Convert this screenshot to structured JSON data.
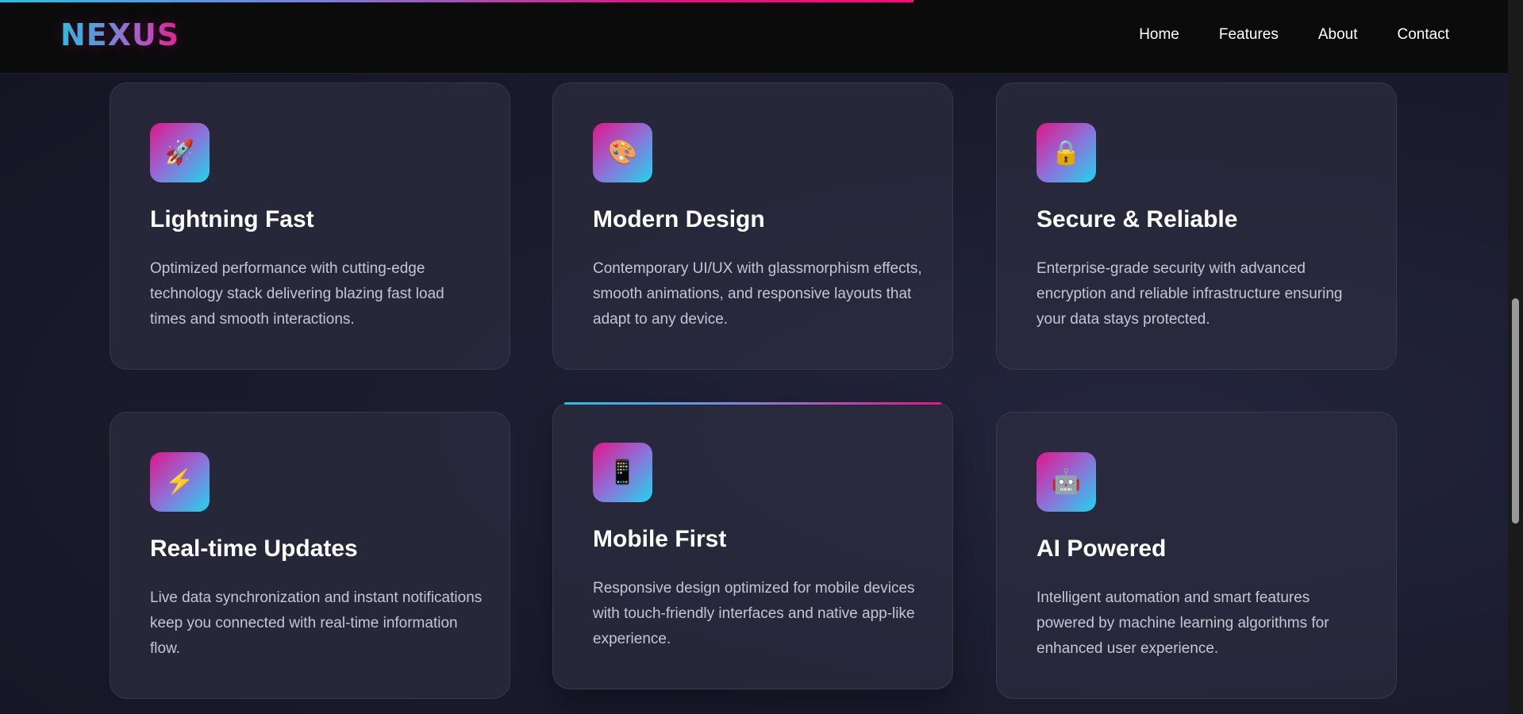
{
  "brand": {
    "logo": "NEXUS"
  },
  "nav": {
    "links": [
      "Home",
      "Features",
      "About",
      "Contact"
    ]
  },
  "scroll_progress": 0.6,
  "colors": {
    "accent_cyan": "#22c1e6",
    "accent_pink": "#e0158a",
    "card_background": "#2c2d40"
  },
  "features": [
    {
      "icon": "rocket-icon",
      "glyph": "🚀",
      "title": "Lightning Fast",
      "description": "Optimized performance with cutting-edge technology stack delivering blazing fast load times and smooth interactions."
    },
    {
      "icon": "palette-icon",
      "glyph": "🎨",
      "title": "Modern Design",
      "description": "Contemporary UI/UX with glassmorphism effects, smooth animations, and responsive layouts that adapt to any device."
    },
    {
      "icon": "lock-icon",
      "glyph": "🔒",
      "title": "Secure & Reliable",
      "description": "Enterprise-grade security with advanced encryption and reliable infrastructure ensuring your data stays protected."
    },
    {
      "icon": "lightning-icon",
      "glyph": "⚡",
      "title": "Real-time Updates",
      "description": "Live data synchronization and instant notifications keep you connected with real-time information flow."
    },
    {
      "icon": "mobile-icon",
      "glyph": "📱",
      "title": "Mobile First",
      "description": "Responsive design optimized for mobile devices with touch-friendly interfaces and native app-like experience."
    },
    {
      "icon": "robot-icon",
      "glyph": "🤖",
      "title": "AI Powered",
      "description": "Intelligent automation and smart features powered by machine learning algorithms for enhanced user experience."
    }
  ]
}
